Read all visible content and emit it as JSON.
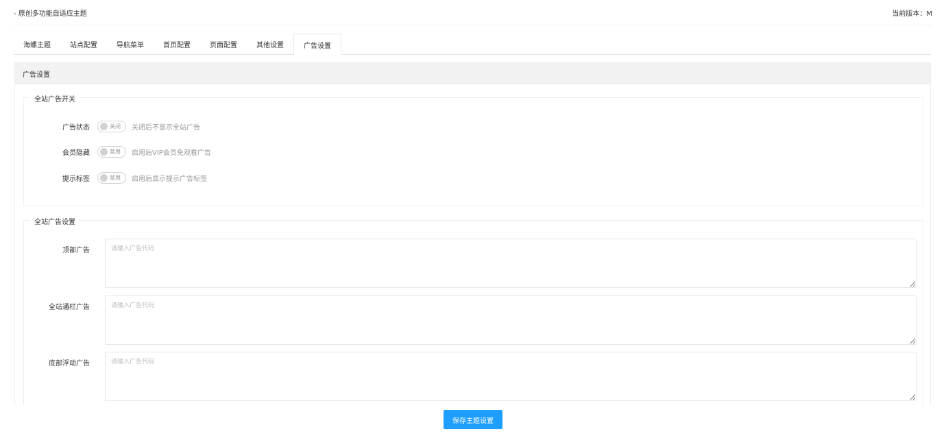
{
  "header": {
    "title": "- 原创多功能自适应主题",
    "version_label": "当前版本：M"
  },
  "tabs": [
    {
      "label": "海螺主题",
      "active": false
    },
    {
      "label": "站点配置",
      "active": false
    },
    {
      "label": "导航菜单",
      "active": false
    },
    {
      "label": "首页配置",
      "active": false
    },
    {
      "label": "页面配置",
      "active": false
    },
    {
      "label": "其他设置",
      "active": false
    },
    {
      "label": "广告设置",
      "active": true
    }
  ],
  "card": {
    "title": "广告设置",
    "switch_section": {
      "legend": "全站广告开关",
      "items": [
        {
          "label": "广告状态",
          "switch_text": "关闭",
          "hint": "关闭后不显示全站广告",
          "on": false
        },
        {
          "label": "会员隐藏",
          "switch_text": "禁用",
          "hint": "启用后VIP会员免观看广告",
          "on": false
        },
        {
          "label": "提示标签",
          "switch_text": "禁用",
          "hint": "启用后显示提示广告标签",
          "on": false
        }
      ]
    },
    "ad_section": {
      "legend": "全站广告设置",
      "items": [
        {
          "label": "顶部广告",
          "value": "",
          "placeholder": "请输入广告代码"
        },
        {
          "label": "全站通栏广告",
          "value": "",
          "placeholder": "请输入广告代码"
        },
        {
          "label": "底部浮动广告",
          "value": "",
          "placeholder": "请输入广告代码"
        }
      ]
    }
  },
  "footer": {
    "save_label": "保存主题设置",
    "save_color": "#1e9fff"
  }
}
